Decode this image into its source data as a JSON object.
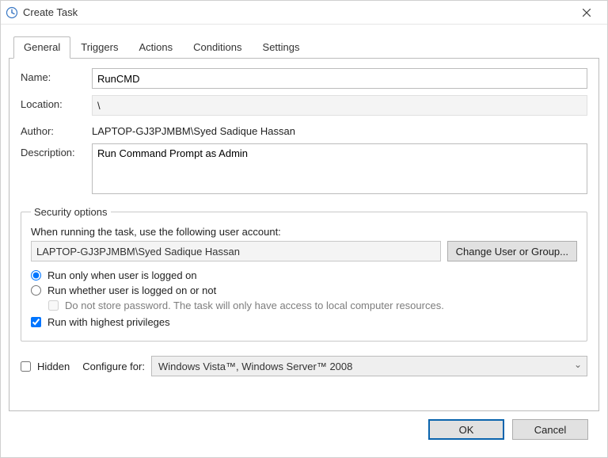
{
  "window": {
    "title": "Create Task"
  },
  "tabs": {
    "items": [
      {
        "label": "General",
        "active": true
      },
      {
        "label": "Triggers"
      },
      {
        "label": "Actions"
      },
      {
        "label": "Conditions"
      },
      {
        "label": "Settings"
      }
    ]
  },
  "fields": {
    "name_label": "Name:",
    "name_value": "RunCMD",
    "location_label": "Location:",
    "location_value": "\\",
    "author_label": "Author:",
    "author_value": "LAPTOP-GJ3PJMBM\\Syed Sadique Hassan",
    "description_label": "Description:",
    "description_value": "Run Command Prompt as Admin"
  },
  "security": {
    "legend": "Security options",
    "prompt": "When running the task, use the following user account:",
    "account": "LAPTOP-GJ3PJMBM\\Syed Sadique Hassan",
    "change_btn": "Change User or Group...",
    "radio_logged_on": "Run only when user is logged on",
    "radio_whether": "Run whether user is logged on or not",
    "no_store_pwd": "Do not store password.  The task will only have access to local computer resources.",
    "highest_priv": "Run with highest privileges"
  },
  "bottom": {
    "hidden_label": "Hidden",
    "configure_label": "Configure for:",
    "configure_value": "Windows Vista™, Windows Server™ 2008"
  },
  "footer": {
    "ok": "OK",
    "cancel": "Cancel"
  }
}
